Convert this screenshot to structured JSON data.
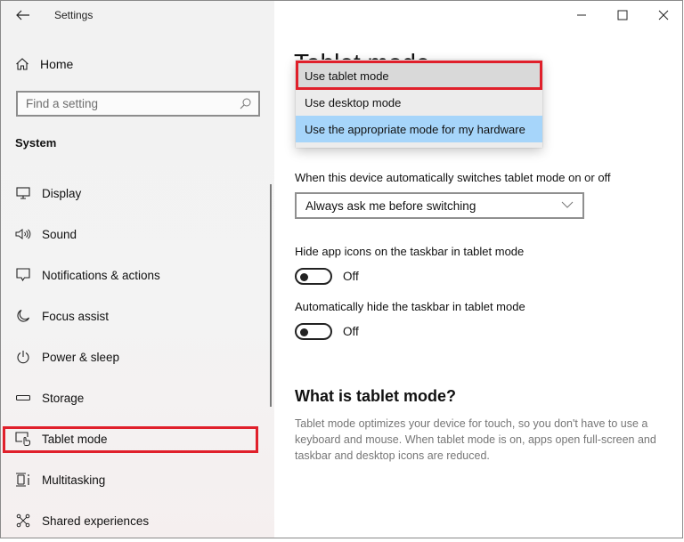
{
  "window": {
    "app_title": "Settings",
    "controls": {
      "minimize_icon": "minimize-icon",
      "maximize_icon": "maximize-icon",
      "close_icon": "close-icon"
    }
  },
  "sidebar": {
    "back_icon": "back-arrow-icon",
    "home": {
      "label": "Home",
      "icon": "home-icon"
    },
    "search": {
      "placeholder": "Find a setting",
      "value": "",
      "icon": "search-icon"
    },
    "section": "System",
    "items": [
      {
        "label": "Display",
        "icon": "display-icon"
      },
      {
        "label": "Sound",
        "icon": "sound-icon"
      },
      {
        "label": "Notifications & actions",
        "icon": "notifications-icon"
      },
      {
        "label": "Focus assist",
        "icon": "moon-icon"
      },
      {
        "label": "Power & sleep",
        "icon": "power-icon"
      },
      {
        "label": "Storage",
        "icon": "storage-icon"
      },
      {
        "label": "Tablet mode",
        "icon": "tablet-mode-icon",
        "active": true,
        "highlighted": true
      },
      {
        "label": "Multitasking",
        "icon": "multitasking-icon"
      },
      {
        "label": "Shared experiences",
        "icon": "shared-experiences-icon"
      }
    ]
  },
  "main": {
    "title": "Tablet mode",
    "signin_dropdown": {
      "options": [
        {
          "label": "Use tablet mode",
          "state": "hover",
          "highlighted": true
        },
        {
          "label": "Use desktop mode",
          "state": "normal"
        },
        {
          "label": "Use the appropriate mode for my hardware",
          "state": "selected"
        }
      ]
    },
    "auto_switch": {
      "label": "When this device automatically switches tablet mode on or off",
      "value": "Always ask me before switching"
    },
    "toggles": [
      {
        "label": "Hide app icons on the taskbar in tablet mode",
        "state": "Off",
        "on": false
      },
      {
        "label": "Automatically hide the taskbar in tablet mode",
        "state": "Off",
        "on": false
      }
    ],
    "info": {
      "title": "What is tablet mode?",
      "text": "Tablet mode optimizes your device for touch, so you don't have to use a keyboard and mouse. When tablet mode is on, apps open full-screen and taskbar and desktop icons are reduced."
    }
  },
  "colors": {
    "highlight_red": "#e0202b",
    "selected_blue": "#a6d5fa",
    "hover_gray": "#d9d9d9",
    "secondary_text": "#767676"
  }
}
